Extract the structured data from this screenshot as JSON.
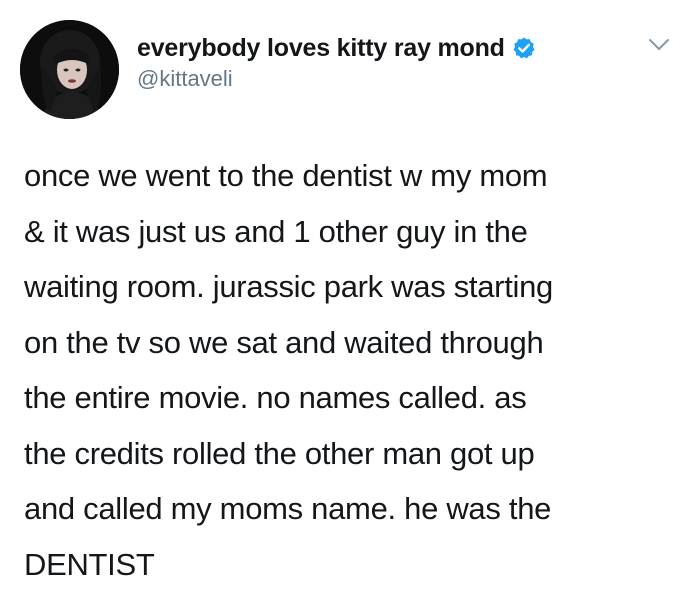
{
  "tweet": {
    "display_name": "everybody loves kitty ray mond",
    "handle": "@kittaveli",
    "verified": true,
    "verified_color": "#1da1f2",
    "icons": {
      "avatar": "profile-photo",
      "verified": "verified-badge-icon",
      "menu": "chevron-down-icon"
    },
    "text_lines": [
      "once we went to the dentist w my mom",
      "& it was just us and 1 other guy in the",
      "waiting room. jurassic park was starting",
      "on the tv so we sat and waited through",
      "the entire movie. no names called. as",
      "the credits rolled the other man got up",
      "and called my moms name. he was the",
      "DENTIST"
    ]
  }
}
